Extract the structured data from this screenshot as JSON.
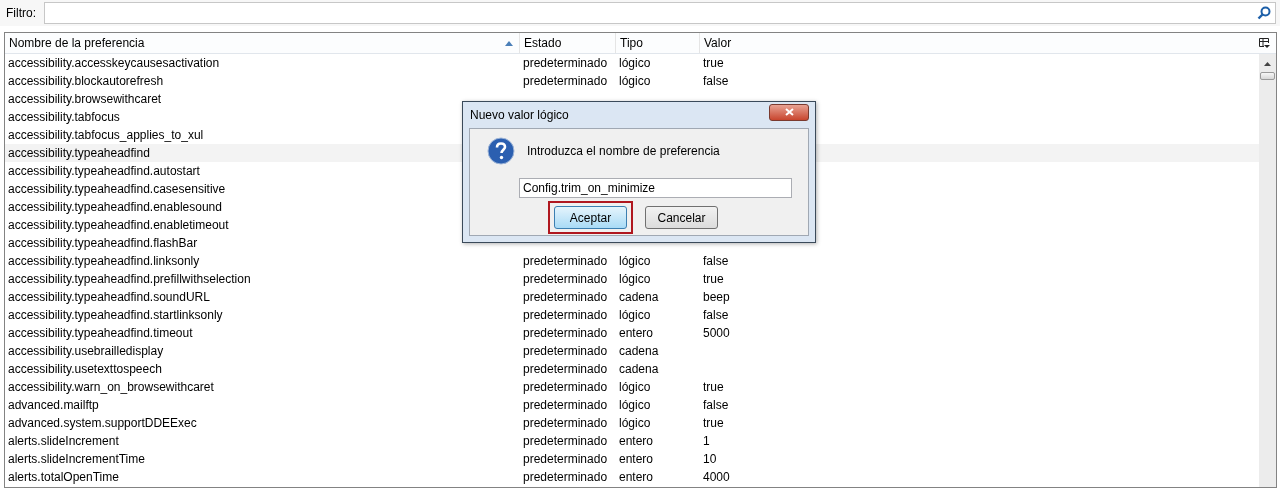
{
  "filter": {
    "label": "Filtro:"
  },
  "table": {
    "columns": [
      {
        "label": "Nombre de la preferencia",
        "sorted": true
      },
      {
        "label": "Estado",
        "sorted": false
      },
      {
        "label": "Tipo",
        "sorted": false
      },
      {
        "label": "Valor",
        "sorted": false
      }
    ],
    "rows": [
      {
        "name": "accessibility.accesskeycausesactivation",
        "status": "predeterminado",
        "type": "lógico",
        "value": "true",
        "selected": false
      },
      {
        "name": "accessibility.blockautorefresh",
        "status": "predeterminado",
        "type": "lógico",
        "value": "false",
        "selected": false
      },
      {
        "name": "accessibility.browsewithcaret",
        "selected": false
      },
      {
        "name": "accessibility.tabfocus",
        "selected": false
      },
      {
        "name": "accessibility.tabfocus_applies_to_xul",
        "selected": false
      },
      {
        "name": "accessibility.typeaheadfind",
        "selected": true
      },
      {
        "name": "accessibility.typeaheadfind.autostart",
        "selected": false
      },
      {
        "name": "accessibility.typeaheadfind.casesensitive",
        "selected": false
      },
      {
        "name": "accessibility.typeaheadfind.enablesound",
        "selected": false
      },
      {
        "name": "accessibility.typeaheadfind.enabletimeout",
        "selected": false
      },
      {
        "name": "accessibility.typeaheadfind.flashBar",
        "selected": false
      },
      {
        "name": "accessibility.typeaheadfind.linksonly",
        "status": "predeterminado",
        "type": "lógico",
        "value": "false",
        "selected": false
      },
      {
        "name": "accessibility.typeaheadfind.prefillwithselection",
        "status": "predeterminado",
        "type": "lógico",
        "value": "true",
        "selected": false
      },
      {
        "name": "accessibility.typeaheadfind.soundURL",
        "status": "predeterminado",
        "type": "cadena",
        "value": "beep",
        "selected": false
      },
      {
        "name": "accessibility.typeaheadfind.startlinksonly",
        "status": "predeterminado",
        "type": "lógico",
        "value": "false",
        "selected": false
      },
      {
        "name": "accessibility.typeaheadfind.timeout",
        "status": "predeterminado",
        "type": "entero",
        "value": "5000",
        "selected": false
      },
      {
        "name": "accessibility.usebrailledisplay",
        "status": "predeterminado",
        "type": "cadena",
        "selected": false
      },
      {
        "name": "accessibility.usetexttospeech",
        "status": "predeterminado",
        "type": "cadena",
        "selected": false
      },
      {
        "name": "accessibility.warn_on_browsewithcaret",
        "status": "predeterminado",
        "type": "lógico",
        "value": "true",
        "selected": false
      },
      {
        "name": "advanced.mailftp",
        "status": "predeterminado",
        "type": "lógico",
        "value": "false",
        "selected": false
      },
      {
        "name": "advanced.system.supportDDEExec",
        "status": "predeterminado",
        "type": "lógico",
        "value": "true",
        "selected": false
      },
      {
        "name": "alerts.slideIncrement",
        "status": "predeterminado",
        "type": "entero",
        "value": "1",
        "selected": false
      },
      {
        "name": "alerts.slideIncrementTime",
        "status": "predeterminado",
        "type": "entero",
        "value": "10",
        "selected": false
      },
      {
        "name": "alerts.totalOpenTime",
        "status": "predeterminado",
        "type": "entero",
        "value": "4000",
        "selected": false
      }
    ]
  },
  "dialog": {
    "title": "Nuevo valor lógico",
    "message": "Introduzca el nombre de preferencia",
    "value": "Config.trim_on_minimize",
    "buttons": [
      {
        "label": "Aceptar",
        "default": true,
        "highlighted": true
      },
      {
        "label": "Cancelar",
        "default": false,
        "highlighted": false
      }
    ]
  }
}
